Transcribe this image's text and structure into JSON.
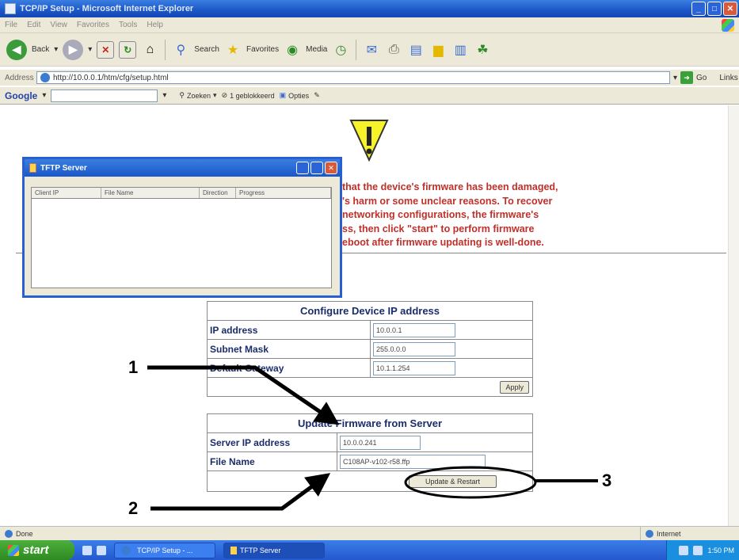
{
  "window": {
    "title": "TCP/IP Setup - Microsoft Internet Explorer"
  },
  "menu": [
    "File",
    "Edit",
    "View",
    "Favorites",
    "Tools",
    "Help"
  ],
  "toolbar": {
    "back": "Back",
    "search": "Search",
    "favorites": "Favorites",
    "media": "Media"
  },
  "address": {
    "label": "Address",
    "url": "http://10.0.0.1/htm/cfg/setup.html",
    "go": "Go",
    "links": "Links"
  },
  "google": {
    "logo": "Google",
    "zoeken": "Zoeken",
    "blocked": "1 geblokkeerd",
    "options": "Opties"
  },
  "warning": {
    "lines": [
      "that the device's firmware has been damaged,",
      "'s harm or some unclear reasons. To recover",
      "networking configurations, the firmware's",
      "ss, then click \"start\" to perform firmware",
      "eboot after firmware updating is well-done."
    ]
  },
  "tftp": {
    "title": "TFTP Server",
    "columns": [
      "Client IP",
      "File Name",
      "Direction",
      "Progress"
    ]
  },
  "ip_config": {
    "header": "Configure Device IP address",
    "rows": [
      {
        "label": "IP address",
        "value": "10.0.0.1"
      },
      {
        "label": "Subnet Mask",
        "value": "255.0.0.0"
      },
      {
        "label": "Default Gateway",
        "value": "10.1.1.254"
      }
    ],
    "apply": "Apply"
  },
  "firmware": {
    "header": "Update Firmware from Server",
    "server_label": "Server IP address",
    "server_value": "10.0.0.241",
    "file_label": "File Name",
    "file_value": "C108AP-v102-r58.ffp",
    "button": "Update & Restart"
  },
  "annotations": {
    "one": "1",
    "two": "2",
    "three": "3"
  },
  "status": {
    "text": "Done",
    "zone": "Internet"
  },
  "taskbar": {
    "start": "start",
    "tasks": [
      "TCP/IP Setup - ...",
      "TFTP Server"
    ],
    "clock": "1:50 PM"
  }
}
